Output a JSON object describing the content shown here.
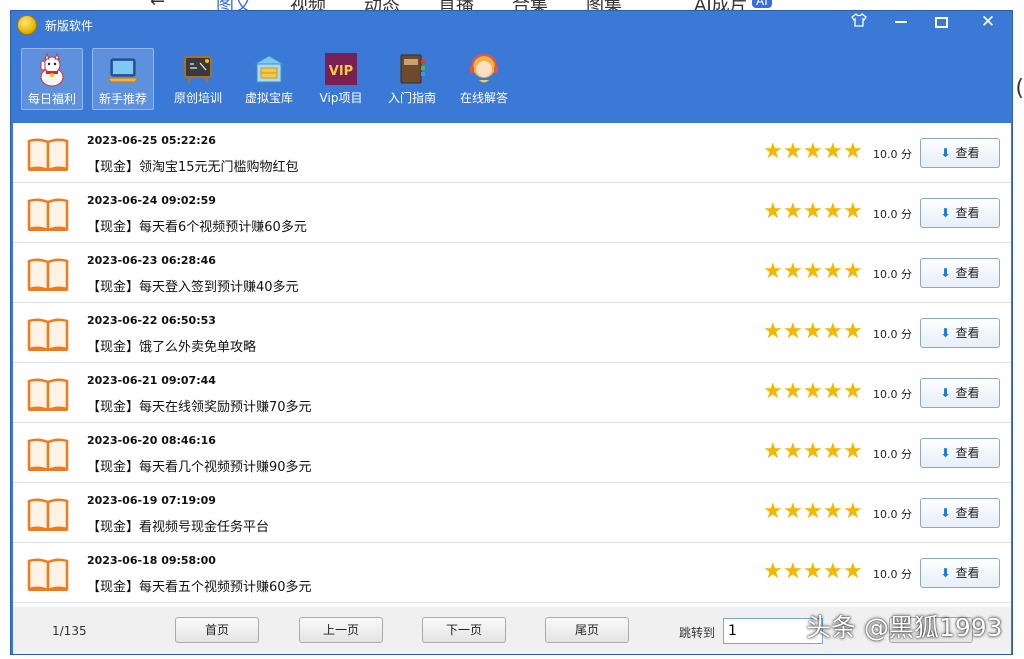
{
  "background": {
    "tabs": [
      "←",
      "图文",
      "视频",
      "动态",
      "直播",
      "合集",
      "图集",
      "AI成片",
      "AI"
    ],
    "right_glyph": "("
  },
  "window": {
    "title": "新版软件",
    "controls": [
      "shirt-icon",
      "minimize-icon",
      "maximize-icon",
      "close-icon"
    ]
  },
  "toolbar": {
    "items": [
      {
        "label": "每日福利",
        "icon": "lucky-cat-icon",
        "active": true
      },
      {
        "label": "新手推荐",
        "icon": "laptop-icon",
        "active": true
      },
      {
        "label": "原创培训",
        "icon": "chalkboard-icon",
        "active": false
      },
      {
        "label": "虚拟宝库",
        "icon": "treasure-house-icon",
        "active": false
      },
      {
        "label": "Vip项目",
        "icon": "vip-icon",
        "active": false
      },
      {
        "label": "入门指南",
        "icon": "guide-book-icon",
        "active": false
      },
      {
        "label": "在线解答",
        "icon": "support-agent-icon",
        "active": false
      }
    ]
  },
  "list": {
    "view_label": "查看",
    "rows": [
      {
        "date": "2023-06-25 05:22:26",
        "title": "【现金】领淘宝15元无门槛购物红包",
        "score": "10.0 分",
        "stars": 5
      },
      {
        "date": "2023-06-24 09:02:59",
        "title": "【现金】每天看6个视频预计赚60多元",
        "score": "10.0 分",
        "stars": 5
      },
      {
        "date": "2023-06-23 06:28:46",
        "title": "【现金】每天登入签到预计赚40多元",
        "score": "10.0 分",
        "stars": 5
      },
      {
        "date": "2023-06-22 06:50:53",
        "title": "【现金】饿了么外卖免单攻略",
        "score": "10.0 分",
        "stars": 5
      },
      {
        "date": "2023-06-21 09:07:44",
        "title": "【现金】每天在线领奖励预计赚70多元",
        "score": "10.0 分",
        "stars": 5
      },
      {
        "date": "2023-06-20 08:46:16",
        "title": "【现金】每天看几个视频预计赚90多元",
        "score": "10.0 分",
        "stars": 5
      },
      {
        "date": "2023-06-19 07:19:09",
        "title": "【现金】看视频号现金任务平台",
        "score": "10.0 分",
        "stars": 5
      },
      {
        "date": "2023-06-18 09:58:00",
        "title": "【现金】每天看五个视频预计赚60多元",
        "score": "10.0 分",
        "stars": 5
      }
    ]
  },
  "pagination": {
    "page_info": "1/135",
    "first": "首页",
    "prev": "上一页",
    "next": "下一页",
    "last": "尾页",
    "jump_label": "跳转到",
    "jump_value": "1"
  },
  "watermark": "头条 @黑狐1993",
  "colors": {
    "window_blue": "#3b79d6",
    "star_gold": "#f5b800",
    "book_orange": "#f07a20"
  }
}
